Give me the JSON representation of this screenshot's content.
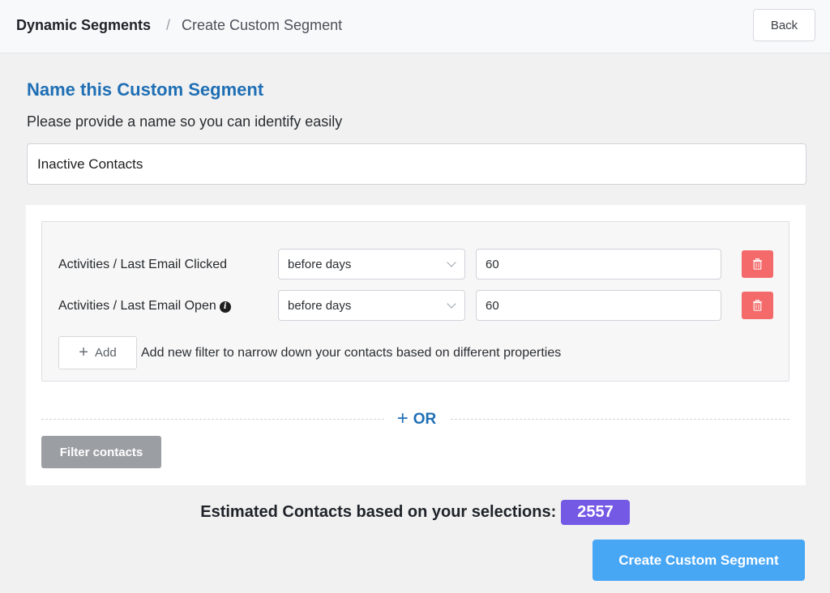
{
  "breadcrumb": {
    "root": "Dynamic Segments",
    "separator": "/",
    "current": "Create Custom Segment"
  },
  "header": {
    "back_label": "Back"
  },
  "name_section": {
    "title": "Name this Custom Segment",
    "description": "Please provide a name so you can identify easily",
    "value": "Inactive Contacts"
  },
  "filters": [
    {
      "label": "Activities / Last Email Clicked",
      "operator": "before days",
      "value": "60",
      "has_info": false
    },
    {
      "label": "Activities / Last Email Open",
      "operator": "before days",
      "value": "60",
      "has_info": true
    }
  ],
  "add": {
    "label": "Add",
    "hint": "Add new filter to narrow down your contacts based on different properties"
  },
  "or_label": "OR",
  "filter_button": "Filter contacts",
  "estimate": {
    "text": "Estimated Contacts based on your selections:",
    "count": "2557"
  },
  "create_button": "Create Custom Segment",
  "colors": {
    "accent": "#1f6fb5",
    "delete": "#f46a6a",
    "badge": "#7459e5",
    "primary_button": "#48a7f5"
  },
  "icons": {
    "delete": "trash-icon",
    "info": "info-icon",
    "dropdown": "chevron-down-icon",
    "add": "plus-icon"
  }
}
